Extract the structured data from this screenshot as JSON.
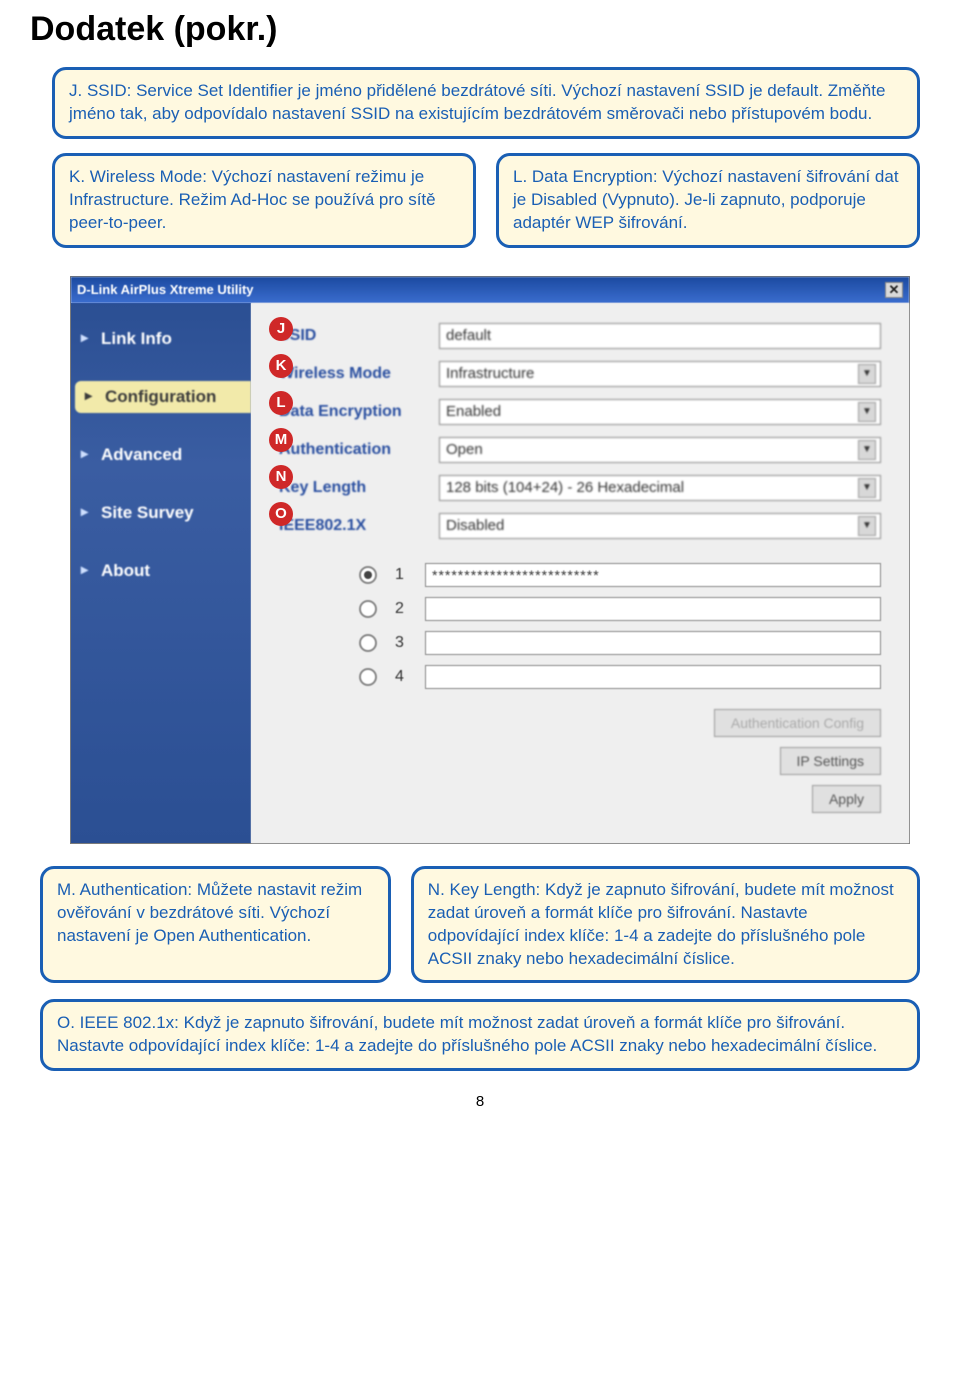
{
  "page": {
    "title": "Dodatek (pokr.)",
    "number": "8"
  },
  "callout_j": {
    "label": "J. SSID:",
    "text": " Service Set Identifier je jméno přidělené bezdrátové síti. Výchozí nastavení SSID je default. Změňte jméno tak, aby odpovídalo nastavení SSID na existujícím bezdrátovém směrovači nebo přístupovém bodu."
  },
  "callout_k": {
    "label": "K. Wireless Mode:",
    "text": " Výchozí nastavení režimu je Infrastructure. Režim Ad-Hoc se používá pro sítě peer-to-peer."
  },
  "callout_l": {
    "label": "L. Data Encryption:",
    "text": " Výchozí nastavení šifrování dat je Disabled (Vypnuto). Je-li zapnuto, podporuje adaptér WEP šifrování."
  },
  "callout_m": {
    "label": "M. Authentication:",
    "text": " Můžete nastavit režim ověřování v bezdrátové síti. Výchozí nastavení je Open Authentication."
  },
  "callout_n": {
    "label": "N. Key Length:",
    "text": " Když je zapnuto šifrování, budete mít možnost zadat úroveň a formát klíče pro šifrování. Nastavte odpovídající index klíče: 1-4 a zadejte do příslušného pole ACSII znaky nebo hexadecimální číslice."
  },
  "callout_o": {
    "label": "O. IEEE 802.1x:",
    "text": " Když je zapnuto šifrování, budete mít možnost zadat úroveň a formát klíče pro šifrování. Nastavte odpovídající index klíče: 1-4 a zadejte do příslušného pole ACSII znaky nebo hexadecimální číslice."
  },
  "markers": [
    "J",
    "K",
    "L",
    "M",
    "N",
    "O"
  ],
  "app": {
    "title": "D-Link AirPlus Xtreme Utility",
    "sidebar": {
      "items": [
        "Link Info",
        "Configuration",
        "Advanced",
        "Site Survey",
        "About"
      ],
      "active": 1
    },
    "form": {
      "ssid_label": "SSID",
      "ssid_value": "default",
      "mode_label": "Wireless Mode",
      "mode_value": "Infrastructure",
      "enc_label": "Data Encryption",
      "enc_value": "Enabled",
      "auth_label": "Authentication",
      "auth_value": "Open",
      "keylen_label": "Key Length",
      "keylen_value": "128 bits (104+24) - 26 Hexadecimal",
      "ieee_label": "IEEE802.1X",
      "ieee_value": "Disabled",
      "keys": [
        {
          "num": "1",
          "value": "**************************",
          "selected": true
        },
        {
          "num": "2",
          "value": "",
          "selected": false
        },
        {
          "num": "3",
          "value": "",
          "selected": false
        },
        {
          "num": "4",
          "value": "",
          "selected": false
        }
      ],
      "btn_authcfg": "Authentication Config",
      "btn_ipsettings": "IP Settings",
      "btn_apply": "Apply"
    }
  }
}
